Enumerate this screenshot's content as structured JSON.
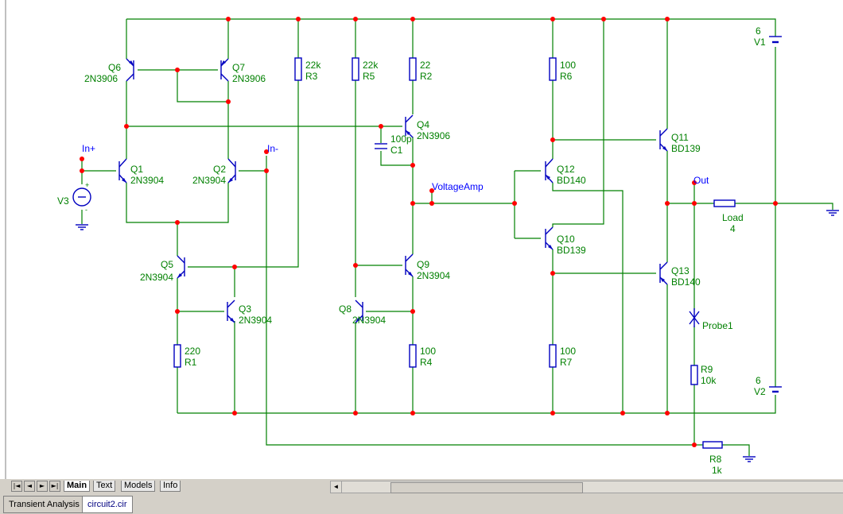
{
  "schematic": {
    "components": {
      "q1": {
        "name": "Q1",
        "type": "2N3904"
      },
      "q2": {
        "name": "Q2",
        "type": "2N3904"
      },
      "q3": {
        "name": "Q3",
        "type": "2N3904"
      },
      "q4": {
        "name": "Q4",
        "type": "2N3906"
      },
      "q5": {
        "name": "Q5",
        "type": "2N3904"
      },
      "q6": {
        "name": "Q6",
        "type": "2N3906"
      },
      "q7": {
        "name": "Q7",
        "type": "2N3906"
      },
      "q8": {
        "name": "Q8",
        "type": "2N3904"
      },
      "q9": {
        "name": "Q9",
        "type": "2N3904"
      },
      "q10": {
        "name": "Q10",
        "type": "BD139"
      },
      "q11": {
        "name": "Q11",
        "type": "BD139"
      },
      "q12": {
        "name": "Q12",
        "type": "BD140"
      },
      "q13": {
        "name": "Q13",
        "type": "BD140"
      },
      "r1": {
        "name": "R1",
        "value": "220"
      },
      "r2": {
        "name": "R2",
        "value": "22"
      },
      "r3": {
        "name": "R3",
        "value": "22k"
      },
      "r4": {
        "name": "R4",
        "value": "100"
      },
      "r5": {
        "name": "R5",
        "value": "22k"
      },
      "r6": {
        "name": "R6",
        "value": "100"
      },
      "r7": {
        "name": "R7",
        "value": "100"
      },
      "r8": {
        "name": "R8",
        "value": "1k"
      },
      "r9": {
        "name": "R9",
        "value": "10k"
      },
      "c1": {
        "name": "C1",
        "value": "100p"
      },
      "v1": {
        "name": "V1",
        "value": "6"
      },
      "v2": {
        "name": "V2",
        "value": "6"
      },
      "v3": {
        "name": "V3"
      },
      "load": {
        "name": "Load",
        "value": "4"
      },
      "probe1": {
        "name": "Probe1"
      }
    },
    "nets": {
      "in_plus": "In+",
      "in_minus": "In-",
      "voltage_amp": "VoltageAmp",
      "out": "Out"
    },
    "source_signs": {
      "plus": "+",
      "minus": "-"
    }
  },
  "bottom_bar": {
    "nav_icons": [
      "first-icon",
      "prev-icon",
      "next-icon",
      "last-icon"
    ],
    "nav_glyphs": [
      "|◄",
      "◄",
      "►",
      "►|"
    ],
    "sheet_tabs": [
      "Main",
      "Text",
      "Models",
      "Info"
    ],
    "active_sheet": "Main",
    "scroll_left_glyph": "◄"
  },
  "window_tabs": {
    "analysis": "Transient Analysis",
    "file": "circuit2.cir"
  },
  "colors": {
    "wire": "#008000",
    "symbol": "#0000c0",
    "node": "#ff0000",
    "net_label": "#0000ff"
  }
}
